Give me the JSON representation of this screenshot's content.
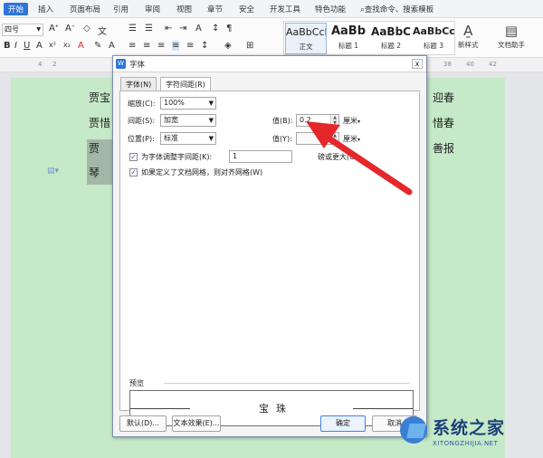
{
  "menubar": {
    "tabs": [
      "开始",
      "插入",
      "页面布局",
      "引用",
      "审阅",
      "视图",
      "章节",
      "安全",
      "开发工具",
      "特色功能"
    ],
    "active_tab": "开始",
    "search_text": "查找命令、搜索模板"
  },
  "toolbar": {
    "font_size": "四号",
    "styles": [
      {
        "sample": "AaBbCcI",
        "name": "正文"
      },
      {
        "sample": "AaBb",
        "name": "标题 1"
      },
      {
        "sample": "AaBbC",
        "name": "标题 2"
      },
      {
        "sample": "AaBbCc",
        "name": "标题 3"
      }
    ],
    "new_style_label": "新样式",
    "doc_helper_label": "文档助手"
  },
  "document": {
    "left_chars": [
      "贾宝",
      "贾惜",
      "贾",
      "琴"
    ],
    "right_chars": [
      "迎春",
      "惜春",
      "善报"
    ]
  },
  "dialog": {
    "title": "字体",
    "close_glyph": "x",
    "tabs": [
      "字体(N)",
      "字符间距(R)"
    ],
    "active_tab": "字符间距(R)",
    "scale_label": "缩放(C):",
    "scale_value": "100%",
    "spacing_label": "间距(S):",
    "spacing_value": "加宽",
    "spacing_by_label": "值(B):",
    "spacing_by_value": "0.2",
    "spacing_unit": "厘米",
    "position_label": "位置(P):",
    "position_value": "标准",
    "position_by_label": "值(Y):",
    "position_by_value": "",
    "position_unit": "厘米",
    "kerning_label": "为字体调整字间距(K):",
    "kerning_value": "1",
    "kerning_suffix": "磅或更大(O)",
    "grid_label": "如果定义了文档网格，则对齐网格(W)",
    "preview_label": "预览",
    "preview_text": "宝珠",
    "default_button": "默认(D)...",
    "text_effects_button": "文本效果(E)...",
    "ok_button": "确定",
    "cancel_button": "取消"
  },
  "watermark": {
    "title": "系统之家",
    "url": "XITONGZHIJIA.NET"
  },
  "colors": {
    "accent": "#2e75d9",
    "page_bg": "#c6e9c8",
    "arrow": "#e5262b"
  }
}
